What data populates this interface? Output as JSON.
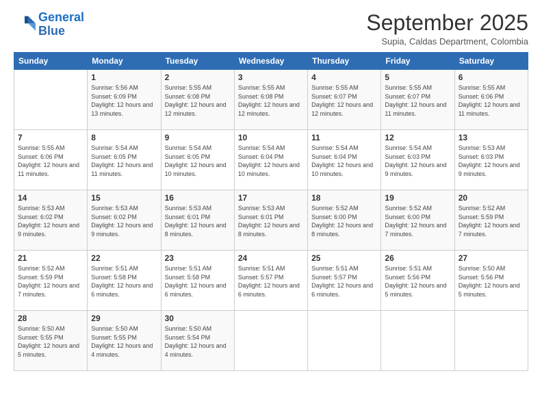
{
  "logo": {
    "line1": "General",
    "line2": "Blue"
  },
  "title": "September 2025",
  "subtitle": "Supia, Caldas Department, Colombia",
  "weekdays": [
    "Sunday",
    "Monday",
    "Tuesday",
    "Wednesday",
    "Thursday",
    "Friday",
    "Saturday"
  ],
  "weeks": [
    [
      {
        "day": "",
        "sunrise": "",
        "sunset": "",
        "daylight": ""
      },
      {
        "day": "1",
        "sunrise": "Sunrise: 5:56 AM",
        "sunset": "Sunset: 6:09 PM",
        "daylight": "Daylight: 12 hours and 13 minutes."
      },
      {
        "day": "2",
        "sunrise": "Sunrise: 5:55 AM",
        "sunset": "Sunset: 6:08 PM",
        "daylight": "Daylight: 12 hours and 12 minutes."
      },
      {
        "day": "3",
        "sunrise": "Sunrise: 5:55 AM",
        "sunset": "Sunset: 6:08 PM",
        "daylight": "Daylight: 12 hours and 12 minutes."
      },
      {
        "day": "4",
        "sunrise": "Sunrise: 5:55 AM",
        "sunset": "Sunset: 6:07 PM",
        "daylight": "Daylight: 12 hours and 12 minutes."
      },
      {
        "day": "5",
        "sunrise": "Sunrise: 5:55 AM",
        "sunset": "Sunset: 6:07 PM",
        "daylight": "Daylight: 12 hours and 11 minutes."
      },
      {
        "day": "6",
        "sunrise": "Sunrise: 5:55 AM",
        "sunset": "Sunset: 6:06 PM",
        "daylight": "Daylight: 12 hours and 11 minutes."
      }
    ],
    [
      {
        "day": "7",
        "sunrise": "Sunrise: 5:55 AM",
        "sunset": "Sunset: 6:06 PM",
        "daylight": "Daylight: 12 hours and 11 minutes."
      },
      {
        "day": "8",
        "sunrise": "Sunrise: 5:54 AM",
        "sunset": "Sunset: 6:05 PM",
        "daylight": "Daylight: 12 hours and 11 minutes."
      },
      {
        "day": "9",
        "sunrise": "Sunrise: 5:54 AM",
        "sunset": "Sunset: 6:05 PM",
        "daylight": "Daylight: 12 hours and 10 minutes."
      },
      {
        "day": "10",
        "sunrise": "Sunrise: 5:54 AM",
        "sunset": "Sunset: 6:04 PM",
        "daylight": "Daylight: 12 hours and 10 minutes."
      },
      {
        "day": "11",
        "sunrise": "Sunrise: 5:54 AM",
        "sunset": "Sunset: 6:04 PM",
        "daylight": "Daylight: 12 hours and 10 minutes."
      },
      {
        "day": "12",
        "sunrise": "Sunrise: 5:54 AM",
        "sunset": "Sunset: 6:03 PM",
        "daylight": "Daylight: 12 hours and 9 minutes."
      },
      {
        "day": "13",
        "sunrise": "Sunrise: 5:53 AM",
        "sunset": "Sunset: 6:03 PM",
        "daylight": "Daylight: 12 hours and 9 minutes."
      }
    ],
    [
      {
        "day": "14",
        "sunrise": "Sunrise: 5:53 AM",
        "sunset": "Sunset: 6:02 PM",
        "daylight": "Daylight: 12 hours and 9 minutes."
      },
      {
        "day": "15",
        "sunrise": "Sunrise: 5:53 AM",
        "sunset": "Sunset: 6:02 PM",
        "daylight": "Daylight: 12 hours and 9 minutes."
      },
      {
        "day": "16",
        "sunrise": "Sunrise: 5:53 AM",
        "sunset": "Sunset: 6:01 PM",
        "daylight": "Daylight: 12 hours and 8 minutes."
      },
      {
        "day": "17",
        "sunrise": "Sunrise: 5:53 AM",
        "sunset": "Sunset: 6:01 PM",
        "daylight": "Daylight: 12 hours and 8 minutes."
      },
      {
        "day": "18",
        "sunrise": "Sunrise: 5:52 AM",
        "sunset": "Sunset: 6:00 PM",
        "daylight": "Daylight: 12 hours and 8 minutes."
      },
      {
        "day": "19",
        "sunrise": "Sunrise: 5:52 AM",
        "sunset": "Sunset: 6:00 PM",
        "daylight": "Daylight: 12 hours and 7 minutes."
      },
      {
        "day": "20",
        "sunrise": "Sunrise: 5:52 AM",
        "sunset": "Sunset: 5:59 PM",
        "daylight": "Daylight: 12 hours and 7 minutes."
      }
    ],
    [
      {
        "day": "21",
        "sunrise": "Sunrise: 5:52 AM",
        "sunset": "Sunset: 5:59 PM",
        "daylight": "Daylight: 12 hours and 7 minutes."
      },
      {
        "day": "22",
        "sunrise": "Sunrise: 5:51 AM",
        "sunset": "Sunset: 5:58 PM",
        "daylight": "Daylight: 12 hours and 6 minutes."
      },
      {
        "day": "23",
        "sunrise": "Sunrise: 5:51 AM",
        "sunset": "Sunset: 5:58 PM",
        "daylight": "Daylight: 12 hours and 6 minutes."
      },
      {
        "day": "24",
        "sunrise": "Sunrise: 5:51 AM",
        "sunset": "Sunset: 5:57 PM",
        "daylight": "Daylight: 12 hours and 6 minutes."
      },
      {
        "day": "25",
        "sunrise": "Sunrise: 5:51 AM",
        "sunset": "Sunset: 5:57 PM",
        "daylight": "Daylight: 12 hours and 6 minutes."
      },
      {
        "day": "26",
        "sunrise": "Sunrise: 5:51 AM",
        "sunset": "Sunset: 5:56 PM",
        "daylight": "Daylight: 12 hours and 5 minutes."
      },
      {
        "day": "27",
        "sunrise": "Sunrise: 5:50 AM",
        "sunset": "Sunset: 5:56 PM",
        "daylight": "Daylight: 12 hours and 5 minutes."
      }
    ],
    [
      {
        "day": "28",
        "sunrise": "Sunrise: 5:50 AM",
        "sunset": "Sunset: 5:55 PM",
        "daylight": "Daylight: 12 hours and 5 minutes."
      },
      {
        "day": "29",
        "sunrise": "Sunrise: 5:50 AM",
        "sunset": "Sunset: 5:55 PM",
        "daylight": "Daylight: 12 hours and 4 minutes."
      },
      {
        "day": "30",
        "sunrise": "Sunrise: 5:50 AM",
        "sunset": "Sunset: 5:54 PM",
        "daylight": "Daylight: 12 hours and 4 minutes."
      },
      {
        "day": "",
        "sunrise": "",
        "sunset": "",
        "daylight": ""
      },
      {
        "day": "",
        "sunrise": "",
        "sunset": "",
        "daylight": ""
      },
      {
        "day": "",
        "sunrise": "",
        "sunset": "",
        "daylight": ""
      },
      {
        "day": "",
        "sunrise": "",
        "sunset": "",
        "daylight": ""
      }
    ]
  ]
}
